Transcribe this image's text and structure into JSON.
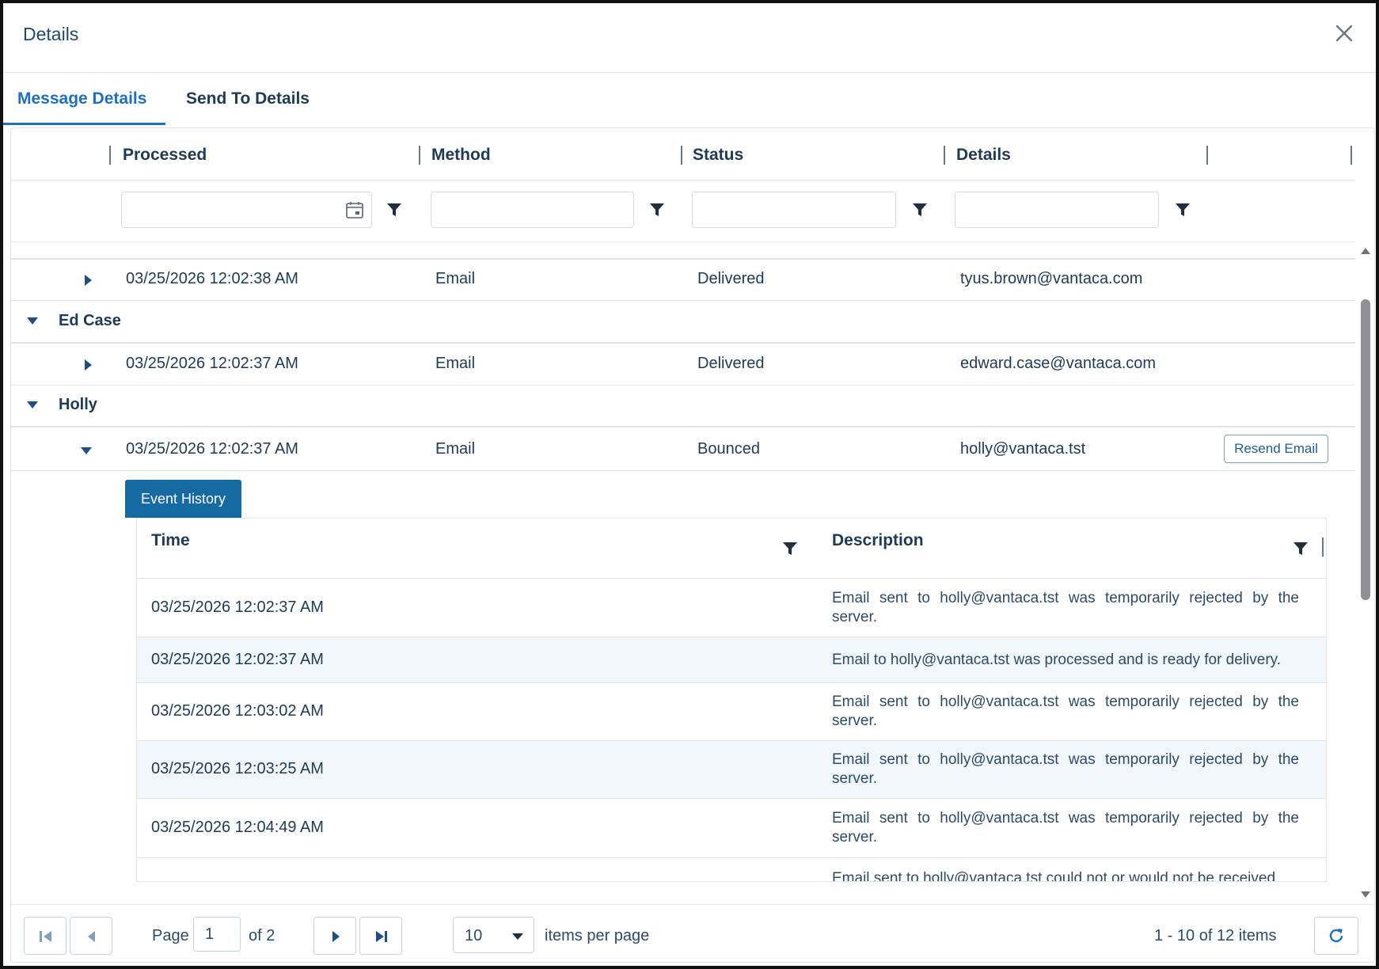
{
  "dialog": {
    "title": "Details",
    "close_icon": "close-icon"
  },
  "tabs": [
    {
      "label": "Message Details",
      "active": true
    },
    {
      "label": "Send To Details",
      "active": false
    }
  ],
  "columns": [
    "Processed",
    "Method",
    "Status",
    "Details"
  ],
  "rows": {
    "first": {
      "processed": "03/25/2026 12:02:38 AM",
      "method": "Email",
      "status": "Delivered",
      "details": "tyus.brown@vantaca.com"
    },
    "groups": [
      {
        "name": "Ed Case",
        "row": {
          "processed": "03/25/2026 12:02:37 AM",
          "method": "Email",
          "status": "Delivered",
          "details": "edward.case@vantaca.com"
        }
      },
      {
        "name": "Holly",
        "row": {
          "processed": "03/25/2026 12:02:37 AM",
          "method": "Email",
          "status": "Bounced",
          "details": "holly@vantaca.tst",
          "action": "Resend Email"
        }
      }
    ]
  },
  "event_history": {
    "tab_label": "Event History",
    "columns": [
      "Time",
      "Description"
    ],
    "rows": [
      {
        "time": "03/25/2026 12:02:37 AM",
        "description": "Email sent to holly@vantaca.tst was temporarily rejected by the server."
      },
      {
        "time": "03/25/2026 12:02:37 AM",
        "description": "Email to holly@vantaca.tst was processed and is ready for delivery."
      },
      {
        "time": "03/25/2026 12:03:02 AM",
        "description": "Email sent to holly@vantaca.tst was temporarily rejected by the server."
      },
      {
        "time": "03/25/2026 12:03:25 AM",
        "description": "Email sent to holly@vantaca.tst was temporarily rejected by the server."
      },
      {
        "time": "03/25/2026 12:04:49 AM",
        "description": "Email sent to holly@vantaca.tst was temporarily rejected by the server."
      },
      {
        "time": "",
        "description": "Email sent to holly@vantaca.tst could not or would not be received"
      }
    ]
  },
  "pager": {
    "page_label": "Page",
    "page_value": "1",
    "of_label": "of 2",
    "page_size": "10",
    "items_per_page_label": "items per page",
    "summary": "1 - 10 of 12 items"
  },
  "colors": {
    "accent": "#1f6fbf",
    "event_tab": "#156aa3",
    "text": "#1f3a55"
  }
}
